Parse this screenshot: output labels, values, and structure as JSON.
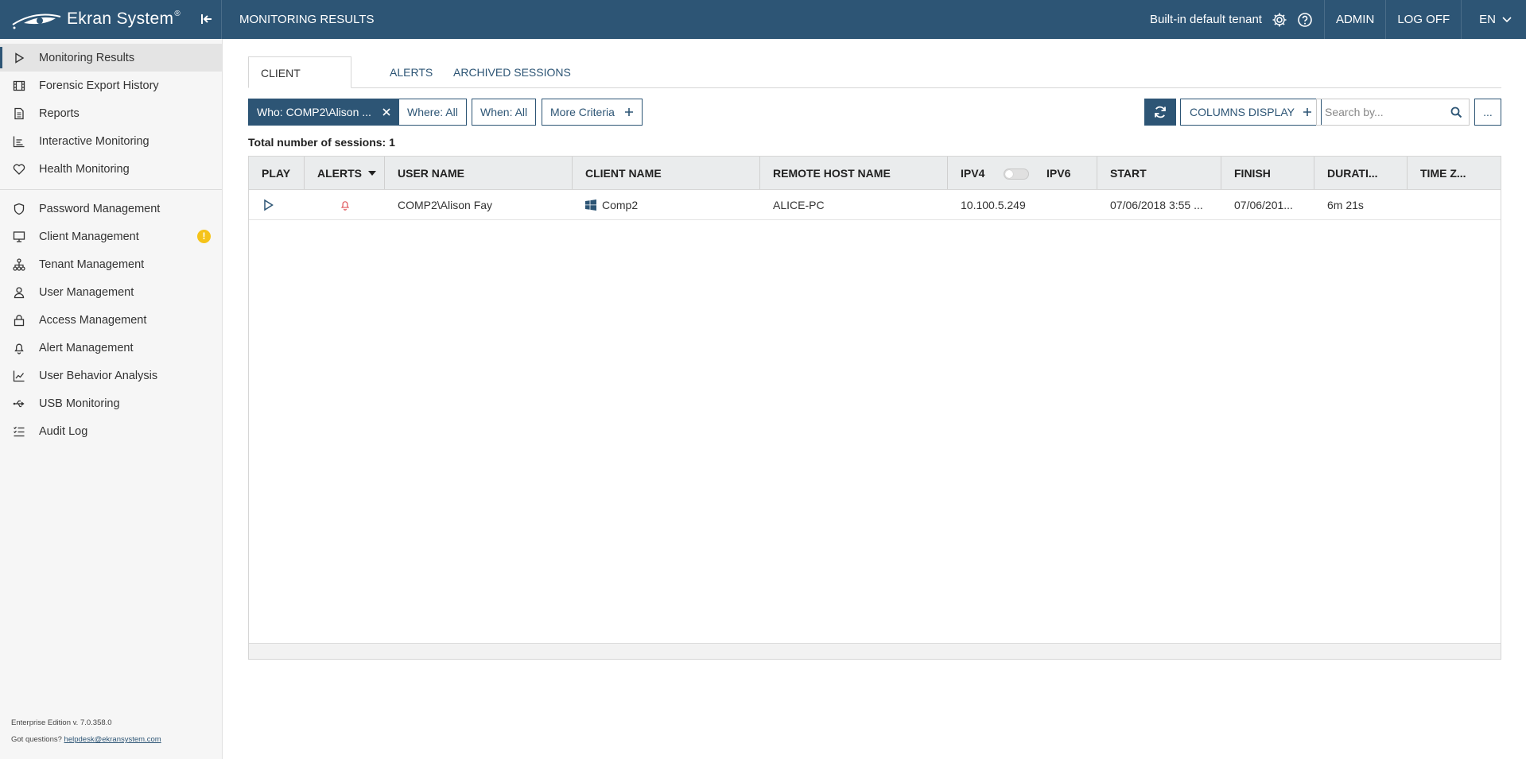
{
  "app": {
    "brand": "Ekran System",
    "brand_mark": "®",
    "page_heading": "MONITORING RESULTS"
  },
  "topbar": {
    "tenant": "Built-in default tenant",
    "user": "ADMIN",
    "logoff": "LOG OFF",
    "language": "EN"
  },
  "sidebar": {
    "items": [
      {
        "label": "Monitoring Results",
        "icon": "play-icon",
        "active": true
      },
      {
        "label": "Forensic Export History",
        "icon": "film-icon"
      },
      {
        "label": "Reports",
        "icon": "document-icon"
      },
      {
        "label": "Interactive Monitoring",
        "icon": "bar-chart-icon"
      },
      {
        "label": "Health Monitoring",
        "icon": "heart-icon"
      }
    ],
    "items2": [
      {
        "label": "Password Management",
        "icon": "shield-icon"
      },
      {
        "label": "Client Management",
        "icon": "monitor-icon",
        "badge": "!"
      },
      {
        "label": "Tenant Management",
        "icon": "hierarchy-icon"
      },
      {
        "label": "User Management",
        "icon": "user-icon"
      },
      {
        "label": "Access Management",
        "icon": "lock-icon"
      },
      {
        "label": "Alert Management",
        "icon": "bell-icon"
      },
      {
        "label": "User Behavior Analysis",
        "icon": "trend-icon"
      },
      {
        "label": "USB Monitoring",
        "icon": "usb-icon"
      },
      {
        "label": "Audit Log",
        "icon": "checklist-icon"
      }
    ],
    "footer": {
      "edition": "Enterprise Edition v. 7.0.358.0",
      "questions": "Got questions?",
      "email": "helpdesk@ekransystem.com"
    }
  },
  "tabs": [
    {
      "label": "CLIENT SESSIONS",
      "active": true
    },
    {
      "label": "ALERTS"
    },
    {
      "label": "ARCHIVED SESSIONS"
    }
  ],
  "filters": {
    "who": "Who: COMP2\\Alison ...",
    "where": "Where: All",
    "when": "When: All",
    "more": "More Criteria",
    "columns_display": "COLUMNS DISPLAY",
    "search_placeholder": "Search by...",
    "more_actions": "..."
  },
  "summary": {
    "total": "Total number of sessions: 1"
  },
  "table": {
    "columns": {
      "play": "PLAY",
      "alerts": "ALERTS",
      "user": "USER NAME",
      "client": "CLIENT NAME",
      "remote": "REMOTE HOST NAME",
      "ipv4": "IPV4",
      "ipv6": "IPV6",
      "start": "START",
      "finish": "FINISH",
      "duration": "DURATI...",
      "timezone": "TIME Z..."
    },
    "rows": [
      {
        "user": "COMP2\\Alison Fay",
        "client": "Comp2",
        "remote": "ALICE-PC",
        "ip": "10.100.5.249",
        "start": "07/06/2018 3:55 ...",
        "finish": "07/06/201...",
        "duration": "6m 21s",
        "timezone": ""
      }
    ]
  },
  "colors": {
    "primary": "#2d5575",
    "badge": "#f5c319",
    "alert_bell": "#e0565b"
  }
}
